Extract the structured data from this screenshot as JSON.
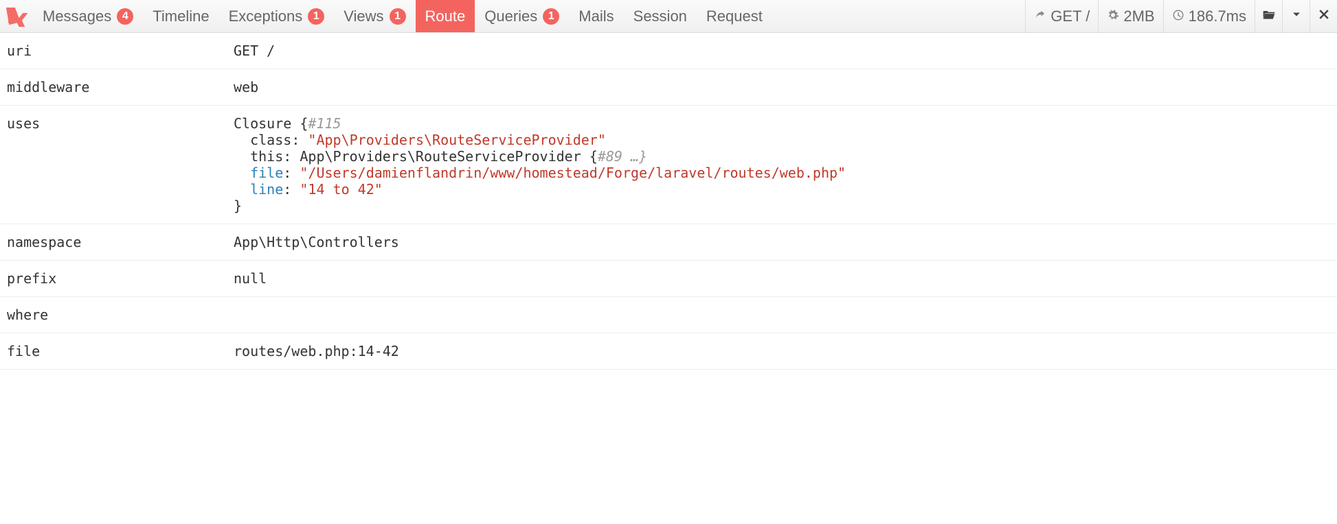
{
  "toolbar": {
    "tabs": [
      {
        "label": "Messages",
        "badge": "4"
      },
      {
        "label": "Timeline",
        "badge": null
      },
      {
        "label": "Exceptions",
        "badge": "1"
      },
      {
        "label": "Views",
        "badge": "1"
      },
      {
        "label": "Route",
        "badge": null,
        "active": true
      },
      {
        "label": "Queries",
        "badge": "1"
      },
      {
        "label": "Mails",
        "badge": null
      },
      {
        "label": "Session",
        "badge": null
      },
      {
        "label": "Request",
        "badge": null
      }
    ],
    "request": "GET /",
    "memory": "2MB",
    "time": "186.7ms"
  },
  "rows": {
    "uri": {
      "key": "uri",
      "value": "GET /"
    },
    "middleware": {
      "key": "middleware",
      "value": "web"
    },
    "uses": {
      "key": "uses",
      "closure_label": "Closure {",
      "closure_ref": "#115",
      "class_key": "class",
      "class_val": "\"App\\Providers\\RouteServiceProvider\"",
      "this_key": "this",
      "this_val": "App\\Providers\\RouteServiceProvider {",
      "this_ref": "#89 …}",
      "file_key": "file",
      "file_val": "\"/Users/damienflandrin/www/homestead/Forge/laravel/routes/web.php\"",
      "line_key": "line",
      "line_val": "\"14 to 42\"",
      "close": "}"
    },
    "namespace": {
      "key": "namespace",
      "value": "App\\Http\\Controllers"
    },
    "prefix": {
      "key": "prefix",
      "value": "null"
    },
    "where": {
      "key": "where",
      "value": ""
    },
    "file": {
      "key": "file",
      "value": "routes/web.php:14-42"
    }
  }
}
